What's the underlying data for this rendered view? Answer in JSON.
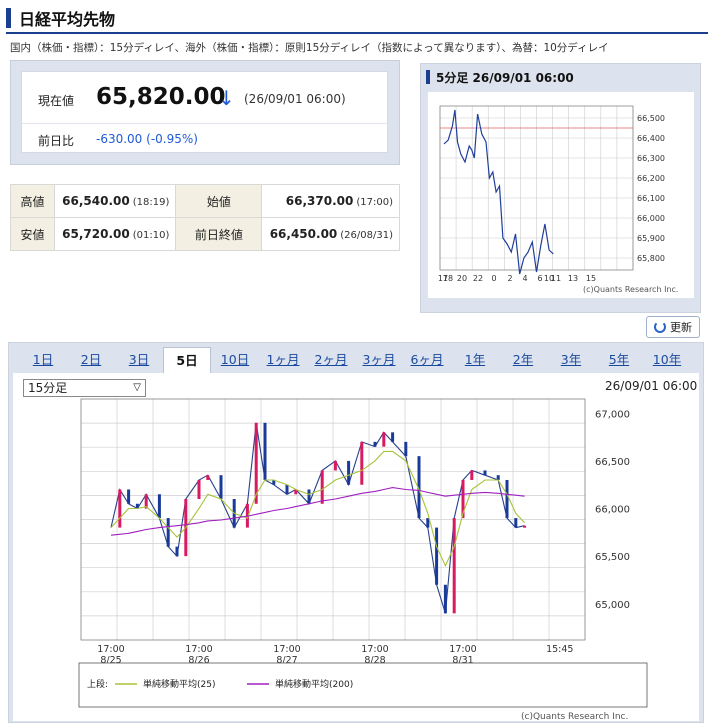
{
  "page": {
    "title": "日経平均先物",
    "delay_note": "国内（株価・指標）：15分ディレイ、海外（株価・指標）：原則15分ディレイ（指数によって異なります）、為替：10分ディレイ"
  },
  "price": {
    "current_label": "現在値",
    "current_value": "65,820.00",
    "arrow": "↓",
    "current_time": "(26/09/01 06:00)",
    "prev_label": "前日比",
    "prev_value": "-630.00 (-0.95%)"
  },
  "stats": {
    "high_label": "高値",
    "high_value": "66,540.00",
    "high_time": "(18:19)",
    "open_label": "始値",
    "open_value": "66,370.00",
    "open_time": "(17:00)",
    "low_label": "安値",
    "low_value": "65,720.00",
    "low_time": "(01:10)",
    "prevclose_label": "前日終値",
    "prevclose_value": "66,450.00",
    "prevclose_time": "(26/08/31)"
  },
  "mini_chart_header": "5分足 26/09/01 06:00",
  "refresh_label": "更新",
  "tabs": [
    "1日",
    "2日",
    "3日",
    "5日",
    "10日",
    "1ヶ月",
    "2ヶ月",
    "3ヶ月",
    "6ヶ月",
    "1年",
    "2年",
    "3年",
    "5年",
    "10年"
  ],
  "active_tab": "5日",
  "interval_select": "15分足",
  "big_chart_time": "26/09/01 06:00",
  "icons": {
    "refresh": "refresh-icon",
    "select": "chevron-down-icon"
  },
  "colors": {
    "accent": "#1a3f8f",
    "down": "#1f5bd6",
    "ma25": "#a8c23a",
    "ma200": "#a020c0",
    "up": "#d81b60"
  },
  "chart_data": [
    {
      "type": "line",
      "title": "5分足 26/09/01 06:00",
      "x_ticks": [
        "17",
        "18",
        "20",
        "22",
        "0",
        "2",
        "4",
        "6",
        "10",
        "11",
        "13",
        "15"
      ],
      "y_ticks": [
        65800,
        65900,
        66000,
        66100,
        66200,
        66300,
        66400,
        66500
      ],
      "ylim": [
        65740,
        66560
      ],
      "reference_line": 66450,
      "hours": [
        17,
        17.5,
        18,
        18.3,
        18.6,
        19,
        19.5,
        20,
        20.3,
        20.6,
        21,
        21.5,
        22,
        22.4,
        22.8,
        23.2,
        23.6,
        24,
        24.5,
        25,
        25.5,
        26,
        26.5,
        27,
        27.5,
        28,
        28.5,
        29,
        29.5,
        30
      ],
      "values": [
        66370,
        66390,
        66460,
        66540,
        66380,
        66320,
        66280,
        66360,
        66340,
        66300,
        66520,
        66420,
        66380,
        66200,
        66230,
        66130,
        66160,
        65900,
        65870,
        65830,
        65920,
        65720,
        65800,
        65830,
        65880,
        65730,
        65860,
        65970,
        65840,
        65820
      ],
      "credit": "(c)Quants Research Inc."
    },
    {
      "type": "line",
      "series": [
        {
          "name": "単純移動平均(25)",
          "color": "#a8c23a"
        },
        {
          "name": "単純移動平均(200)",
          "color": "#a020c0"
        }
      ],
      "legend_label": "上段:",
      "x_ticks": [
        {
          "t": 0,
          "l1": "17:00",
          "l2": "8/25"
        },
        {
          "t": 1,
          "l1": "17:00",
          "l2": "8/26"
        },
        {
          "t": 2,
          "l1": "17:00",
          "l2": "8/27"
        },
        {
          "t": 3,
          "l1": "17:00",
          "l2": "8/28"
        },
        {
          "t": 4,
          "l1": "17:00",
          "l2": "8/31"
        },
        {
          "t": 5.1,
          "l1": "15:45",
          "l2": ""
        }
      ],
      "y_ticks": [
        "67,000",
        "66,500",
        "66,000",
        "65,500",
        "65,000"
      ],
      "y_tick_values": [
        67000,
        66500,
        66000,
        65500,
        65000
      ],
      "ylim": [
        64620,
        67150
      ],
      "days": [
        0,
        0.1,
        0.2,
        0.3,
        0.4,
        0.55,
        0.65,
        0.75,
        0.85,
        1.0,
        1.1,
        1.25,
        1.4,
        1.55,
        1.65,
        1.75,
        1.85,
        2.0,
        2.1,
        2.25,
        2.4,
        2.55,
        2.7,
        2.85,
        3.0,
        3.1,
        3.2,
        3.35,
        3.5,
        3.6,
        3.7,
        3.8,
        3.9,
        4.0,
        4.1,
        4.25,
        4.4,
        4.5,
        4.6,
        4.7
      ],
      "close": [
        65800,
        66200,
        66050,
        66000,
        66150,
        65900,
        65600,
        65500,
        66100,
        66300,
        66350,
        66100,
        65800,
        66050,
        66900,
        66300,
        66250,
        66150,
        66200,
        66050,
        66400,
        66500,
        66250,
        66700,
        66650,
        66800,
        66700,
        66550,
        65900,
        65800,
        65200,
        64900,
        65900,
        66300,
        66400,
        66350,
        66300,
        65900,
        65800,
        65820
      ],
      "ma25": [
        65800,
        65900,
        66000,
        66000,
        66020,
        65900,
        65800,
        65700,
        65800,
        66000,
        66150,
        66100,
        65950,
        65900,
        66150,
        66300,
        66300,
        66250,
        66200,
        66150,
        66200,
        66300,
        66350,
        66400,
        66500,
        66600,
        66600,
        66500,
        66200,
        65950,
        65600,
        65400,
        65600,
        65950,
        66200,
        66300,
        66300,
        66150,
        65950,
        65850
      ],
      "ma200": [
        65720,
        65730,
        65740,
        65760,
        65780,
        65800,
        65810,
        65820,
        65830,
        65850,
        65870,
        65880,
        65900,
        65920,
        65940,
        65960,
        65980,
        66000,
        66020,
        66050,
        66080,
        66100,
        66130,
        66160,
        66180,
        66200,
        66220,
        66200,
        66190,
        66170,
        66150,
        66130,
        66140,
        66150,
        66160,
        66170,
        66160,
        66150,
        66140,
        66130
      ],
      "credit": "(c)Quants Research Inc."
    }
  ]
}
